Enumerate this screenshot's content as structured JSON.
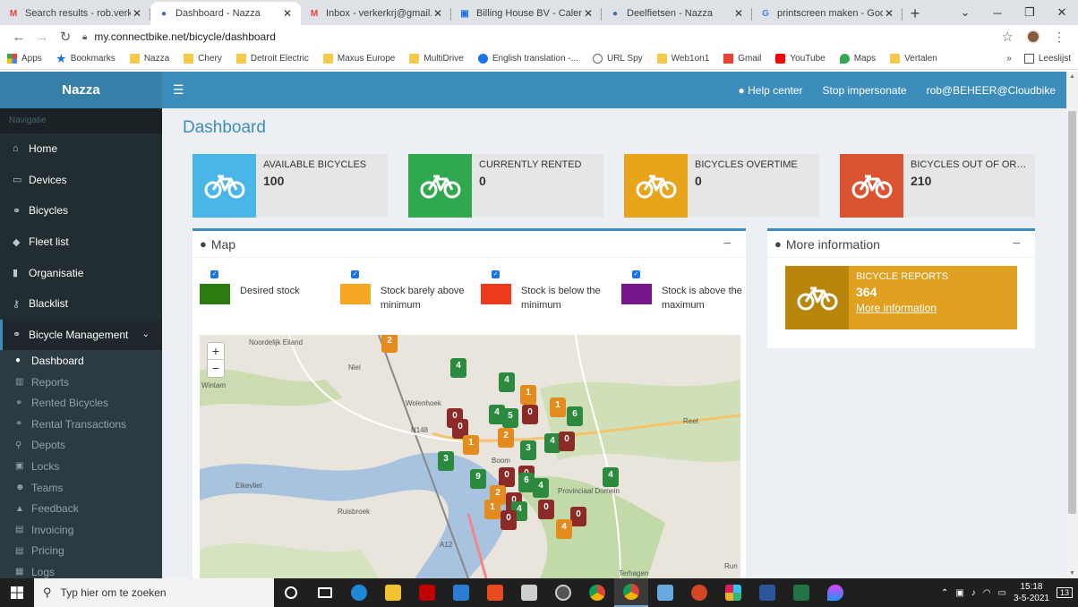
{
  "browser": {
    "tabs": [
      {
        "label": "Search results - rob.verkerk",
        "icon": "gmail-icon",
        "active": false
      },
      {
        "label": "Dashboard - Nazza",
        "icon": "globe-icon",
        "active": true
      },
      {
        "label": "Inbox - verkerkrj@gmail.com",
        "icon": "gmail-icon",
        "active": false
      },
      {
        "label": "Billing House BV - Calendar",
        "icon": "calendar-icon",
        "active": false
      },
      {
        "label": "Deelfietsen - Nazza",
        "icon": "globe-icon",
        "active": false
      },
      {
        "label": "printscreen maken - Google",
        "icon": "google-icon",
        "active": false
      }
    ],
    "url": "my.connectbike.net/bicycle/dashboard",
    "bookmarks": [
      {
        "label": "Apps",
        "icon": "apps-icon"
      },
      {
        "label": "Bookmarks",
        "icon": "star-icon"
      },
      {
        "label": "Nazza",
        "icon": "folder-icon"
      },
      {
        "label": "Chery",
        "icon": "folder-icon"
      },
      {
        "label": "Detroit Electric",
        "icon": "folder-icon"
      },
      {
        "label": "Maxus Europe",
        "icon": "folder-icon"
      },
      {
        "label": "MultiDrive",
        "icon": "folder-icon"
      },
      {
        "label": "English translation -...",
        "icon": "translate-icon"
      },
      {
        "label": "URL Spy",
        "icon": "check-icon"
      },
      {
        "label": "Web1on1",
        "icon": "folder-icon"
      },
      {
        "label": "Gmail",
        "icon": "gmail-icon"
      },
      {
        "label": "YouTube",
        "icon": "youtube-icon"
      },
      {
        "label": "Maps",
        "icon": "maps-icon"
      },
      {
        "label": "Vertalen",
        "icon": "folder-icon"
      }
    ],
    "more": "»",
    "reading_list": "Leeslijst"
  },
  "header": {
    "brand": "Nazza",
    "help": "Help center",
    "stop": "Stop impersonate",
    "user": "rob@BEHEER@Cloudbike"
  },
  "sidebar": {
    "section": "Navigatie",
    "items": [
      {
        "label": "Home",
        "icon": "home-icon",
        "glyph": "⌂"
      },
      {
        "label": "Devices",
        "icon": "laptop-icon",
        "glyph": "▭"
      },
      {
        "label": "Bicycles",
        "icon": "bicycle-icon",
        "glyph": "⚭"
      },
      {
        "label": "Fleet list",
        "icon": "tag-icon",
        "glyph": "◆"
      },
      {
        "label": "Organisatie",
        "icon": "building-icon",
        "glyph": "▮"
      },
      {
        "label": "Blacklist",
        "icon": "key-icon",
        "glyph": "⚷"
      }
    ],
    "group": {
      "label": "Bicycle Management",
      "icon": "bicycle-icon",
      "glyph": "⚭"
    },
    "subitems": [
      {
        "label": "Dashboard",
        "icon": "globe-icon",
        "glyph": "●",
        "active": true
      },
      {
        "label": "Reports",
        "icon": "bar-chart-icon",
        "glyph": "▥",
        "active": false
      },
      {
        "label": "Rented Bicycles",
        "icon": "bicycle-icon",
        "glyph": "⚭",
        "active": false
      },
      {
        "label": "Rental Transactions",
        "icon": "bicycle-icon",
        "glyph": "⚭",
        "active": false
      },
      {
        "label": "Depots",
        "icon": "map-marker-icon",
        "glyph": "⚲",
        "active": false
      },
      {
        "label": "Locks",
        "icon": "lock-icon",
        "glyph": "▣",
        "active": false
      },
      {
        "label": "Teams",
        "icon": "users-icon",
        "glyph": "☻",
        "active": false
      },
      {
        "label": "Feedback",
        "icon": "warning-icon",
        "glyph": "▲",
        "active": false
      },
      {
        "label": "Invoicing",
        "icon": "money-icon",
        "glyph": "▤",
        "active": false
      },
      {
        "label": "Pricing",
        "icon": "money-icon",
        "glyph": "▤",
        "active": false
      },
      {
        "label": "Logs",
        "icon": "table-icon",
        "glyph": "▦",
        "active": false
      }
    ]
  },
  "page_title": "Dashboard",
  "stats": [
    {
      "label": "AVAILABLE BICYCLES",
      "value": "100",
      "color": "#49b6e8"
    },
    {
      "label": "CURRENTLY RENTED",
      "value": "0",
      "color": "#2fa84f"
    },
    {
      "label": "BICYCLES OVERTIME",
      "value": "0",
      "color": "#e8a41b"
    },
    {
      "label": "BICYCLES OUT OF ORDER",
      "value": "210",
      "color": "#db5432"
    }
  ],
  "map_box": {
    "title": "Map",
    "legend": [
      {
        "label": "Desired stock",
        "color": "#2b7d0f",
        "checked": true
      },
      {
        "label": "Stock barely above minimum",
        "color": "#f5a623",
        "checked": true
      },
      {
        "label": "Stock is below the minimum",
        "color": "#ec3b1c",
        "checked": true
      },
      {
        "label": "Stock is above the maximum",
        "color": "#76168a",
        "checked": true
      }
    ],
    "zoom_in": "+",
    "zoom_out": "−",
    "places": [
      "Noordelijk Eiland",
      "Niel",
      "Wintam",
      "Wolenhoek",
      "N148",
      "Boom",
      "Reet",
      "Eikevliet",
      "Ruisbroek",
      "Provinciaal Domein",
      "A12",
      "Terhagen",
      "Run"
    ],
    "pins": [
      {
        "v": "2",
        "c": "o"
      },
      {
        "v": "4",
        "c": "g"
      },
      {
        "v": "4",
        "c": "g"
      },
      {
        "v": "1",
        "c": "o"
      },
      {
        "v": "0",
        "c": "r"
      },
      {
        "v": "4",
        "c": "g"
      },
      {
        "v": "5",
        "c": "g"
      },
      {
        "v": "0",
        "c": "r"
      },
      {
        "v": "1",
        "c": "o"
      },
      {
        "v": "6",
        "c": "g"
      },
      {
        "v": "0",
        "c": "r"
      },
      {
        "v": "2",
        "c": "o"
      },
      {
        "v": "1",
        "c": "o"
      },
      {
        "v": "3",
        "c": "g"
      },
      {
        "v": "4",
        "c": "g"
      },
      {
        "v": "0",
        "c": "r"
      },
      {
        "v": "3",
        "c": "g"
      },
      {
        "v": "9",
        "c": "g"
      },
      {
        "v": "0",
        "c": "r"
      },
      {
        "v": "0",
        "c": "r"
      },
      {
        "v": "6",
        "c": "g"
      },
      {
        "v": "4",
        "c": "g"
      },
      {
        "v": "4",
        "c": "g"
      },
      {
        "v": "2",
        "c": "o"
      },
      {
        "v": "0",
        "c": "r"
      },
      {
        "v": "1",
        "c": "o"
      },
      {
        "v": "4",
        "c": "g"
      },
      {
        "v": "0",
        "c": "r"
      },
      {
        "v": "0",
        "c": "r"
      },
      {
        "v": "0",
        "c": "r"
      },
      {
        "v": "4",
        "c": "o"
      }
    ]
  },
  "info_box": {
    "title": "More information",
    "report_label": "BICYCLE REPORTS",
    "report_value": "364",
    "report_link": "More information"
  },
  "taskbar": {
    "search_placeholder": "Typ hier om te zoeken",
    "time": "15:18",
    "date": "3-5-2021",
    "notifications": "13"
  }
}
